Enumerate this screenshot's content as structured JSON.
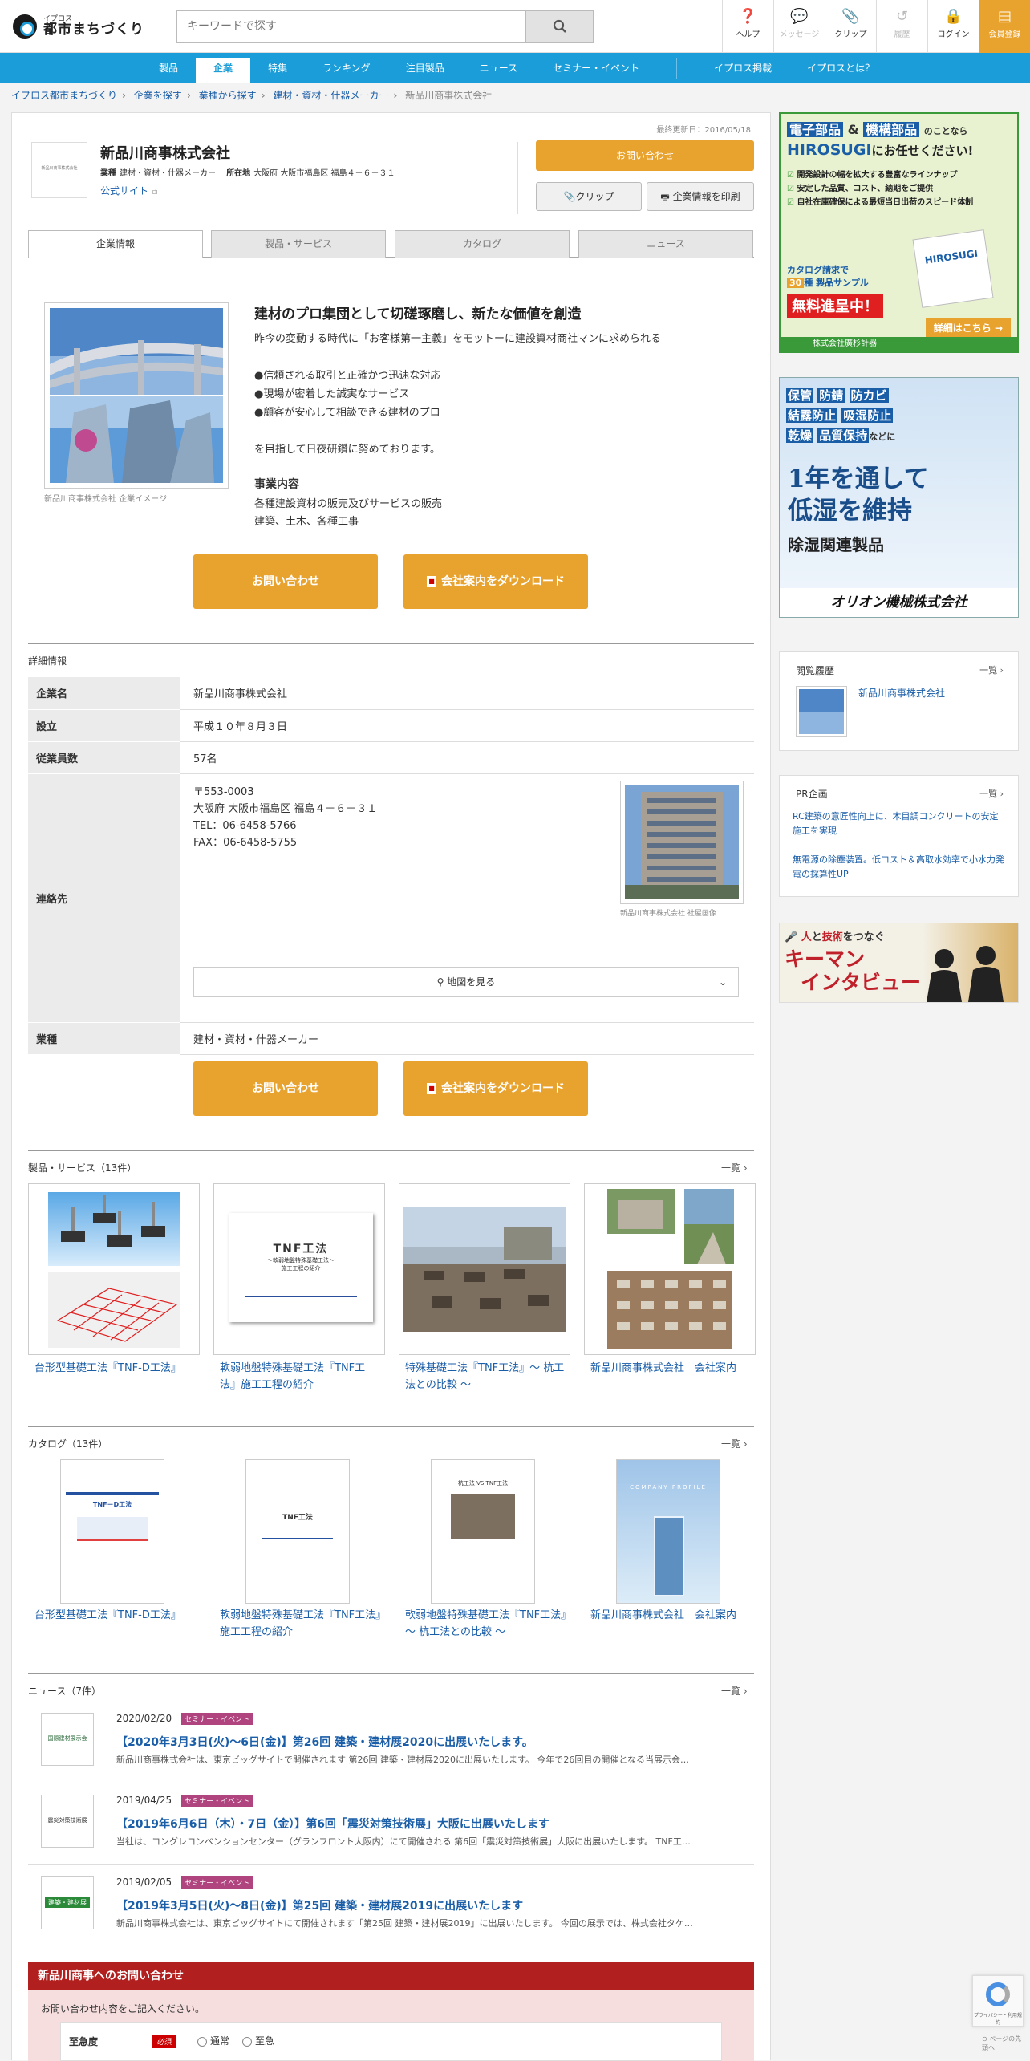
{
  "header": {
    "logo_small": "イプロス",
    "logo_main": "都市まちづくり",
    "search_placeholder": "キーワードで探す",
    "util": [
      {
        "label": "ヘルプ",
        "icon": "help-icon"
      },
      {
        "label": "メッセージ",
        "icon": "message-icon"
      },
      {
        "label": "クリップ",
        "icon": "clip-icon"
      },
      {
        "label": "履歴",
        "icon": "history-icon"
      },
      {
        "label": "ログイン",
        "icon": "lock-icon"
      },
      {
        "label": "会員登録",
        "icon": "register-icon"
      }
    ]
  },
  "nav": [
    "製品",
    "企業",
    "特集",
    "ランキング",
    "注目製品",
    "ニュース",
    "セミナー・イベント",
    "イプロス掲載",
    "イプロスとは？"
  ],
  "breadcrumb": [
    "イプロス都市まちづくり",
    "企業を探す",
    "業種から探す",
    "建材・資材・什器メーカー",
    "新品川商事株式会社"
  ],
  "company": {
    "updated": "最終更新日：2016/05/18",
    "logo_text": "新品川商事株式会社",
    "name": "新品川商事株式会社",
    "industry_label": "業種",
    "industry": "建材・資材・什器メーカー",
    "location_label": "所在地",
    "location": "大阪府 大阪市福島区 福島４－６－３１",
    "site": "公式サイト",
    "inquiry": "お問い合わせ",
    "clip": "クリップ",
    "print": "企業情報を印刷"
  },
  "tabs": [
    "企業情報",
    "製品・サービス",
    "カタログ",
    "ニュース"
  ],
  "intro": {
    "image_caption": "新品川商事株式会社 企業イメージ",
    "heading": "建材のプロ集団として切磋琢磨し、新たな価値を創造",
    "lines": [
      "昨今の変動する時代に「お客様第一主義」をモットーに建設資材商社マンに求められる",
      "●信頼される取引と正確かつ迅速な対応",
      "●現場が密着した誠実なサービス",
      "●顧客が安心して相談できる建材のプロ",
      "を目指して日夜研鑽に努めております。"
    ],
    "biz_heading": "事業内容",
    "biz_lines": [
      "各種建設資材の販売及びサービスの販売",
      "建築、土木、各種工事"
    ],
    "btn_inquiry": "お問い合わせ",
    "btn_download": "会社案内をダウンロード"
  },
  "details": {
    "title": "詳細情報",
    "rows": [
      {
        "k": "企業名",
        "v": "新品川商事株式会社"
      },
      {
        "k": "設立",
        "v": "平成１０年８月３日"
      },
      {
        "k": "従業員数",
        "v": "57名"
      }
    ],
    "contact_label": "連絡先",
    "contact_lines": [
      "〒553-0003",
      "大阪府 大阪市福島区 福島４－６－３１",
      "TEL：06-6458-5766",
      "FAX：06-6458-5755"
    ],
    "building_caption": "新品川商事株式会社 社屋画像",
    "map_btn": "地図を見る",
    "industry_label": "業種",
    "industry": "建材・資材・什器メーカー"
  },
  "products": {
    "title": "製品・サービス（13件）",
    "more": "一覧",
    "items": [
      "台形型基礎工法『TNF-D工法』",
      "軟弱地盤特殊基礎工法『TNF工法』施工工程の紹介",
      "特殊基礎工法『TNF工法』～ 杭工法との比較 ～",
      "新品川商事株式会社　会社案内"
    ],
    "thumb_text": [
      "TNF工法",
      "～軟弱地盤特殊基礎工法～",
      "施工工程の紹介"
    ]
  },
  "catalogs": {
    "title": "カタログ（13件）",
    "more": "一覧",
    "items": [
      "台形型基礎工法『TNF-D工法』",
      "軟弱地盤特殊基礎工法『TNF工法』施工工程の紹介",
      "軟弱地盤特殊基礎工法『TNF工法』～ 杭工法との比較 ～",
      "新品川商事株式会社　会社案内"
    ],
    "thumb_titles": [
      "TNF－D工法",
      "TNF工法",
      "杭工法 VS TNF工法",
      "COMPANY PROFILE"
    ]
  },
  "news": {
    "title": "ニュース（7件）",
    "more": "一覧",
    "items": [
      {
        "date": "2020/02/20",
        "tag": "セミナー・イベント",
        "title": "【2020年3月3日(火)～6日(金)】第26回 建築・建材展2020に出展いたします。",
        "desc": "新品川商事株式会社は、東京ビッグサイトで開催されます 第26回 建築・建材展2020に出展いたします。 今年で26回目の開催となる当展示会…",
        "thumb": "国際建材展示会"
      },
      {
        "date": "2019/04/25",
        "tag": "セミナー・イベント",
        "title": "【2019年6月6日（木）・7日（金）】第6回「震災対策技術展」大阪に出展いたします",
        "desc": "当社は、コングレコンベンションセンター（グランフロント大阪内）にて開催される 第6回「震災対策技術展」大阪に出展いたします。 TNF工…",
        "thumb": "震災対策技術展"
      },
      {
        "date": "2019/02/05",
        "tag": "セミナー・イベント",
        "title": "【2019年3月5日(火)～8日(金)】第25回 建築・建材展2019に出展いたします",
        "desc": "新品川商事株式会社は、東京ビッグサイトにて開催されます「第25回 建築・建材展2019」に出展いたします。 今回の展示では、株式会社タケ…",
        "thumb": "建築・建材展"
      }
    ]
  },
  "contact_form": {
    "title": "新品川商事へのお問い合わせ",
    "prompt": "お問い合わせ内容をご記入ください。",
    "urgency_label": "至急度",
    "required": "必須",
    "options": [
      "通常",
      "至急"
    ]
  },
  "sidebar": {
    "ad1": {
      "line1a": "電子部品",
      "amp": "&",
      "line1b": "機構部品",
      "line1c": "のことなら",
      "line2": "HIROSUGI",
      "line2b": "にお任せください!",
      "bullets": [
        "開発設計の幅を拡大する豊富なラインナップ",
        "安定した品質、コスト、納期をご提供",
        "自社在庫確保による最短当日出荷のスピード体制"
      ],
      "catalog": "カタログ請求で",
      "sample_num": "30",
      "sample_suffix": "種 製品サンプル",
      "free": "無料進呈中！",
      "detail": "詳細はこちら",
      "company": "株式会社廣杉計器",
      "box_label": "HIROSUGI"
    },
    "ad2": {
      "tags": [
        "保管",
        "防錆",
        "防カビ",
        "結露防止",
        "吸湿防止",
        "乾燥",
        "品質保持"
      ],
      "nado": "などに",
      "big1": "1年を通して",
      "big2": "低湿を維持",
      "product": "除湿関連製品",
      "company": "オリオン機械株式会社"
    },
    "history": {
      "title": "閲覧履歴",
      "more": "一覧",
      "item": "新品川商事株式会社"
    },
    "pr": {
      "title": "PR企画",
      "more": "一覧",
      "items": [
        "RC建築の意匠性向上に、木目調コンクリートの安定施工を実現",
        "無電源の除塵装置。低コスト＆高取水効率で小水力発電の採算性UP"
      ]
    },
    "ad3": {
      "line1a": "人",
      "line1b": "と",
      "line1c": "技術",
      "line1d": "をつなぐ",
      "big1": "キーマン",
      "big2": "インタビュー"
    }
  },
  "recaptcha": {
    "privacy": "プライバシー・利用規約"
  },
  "pagetop": "ページの先頭へ"
}
